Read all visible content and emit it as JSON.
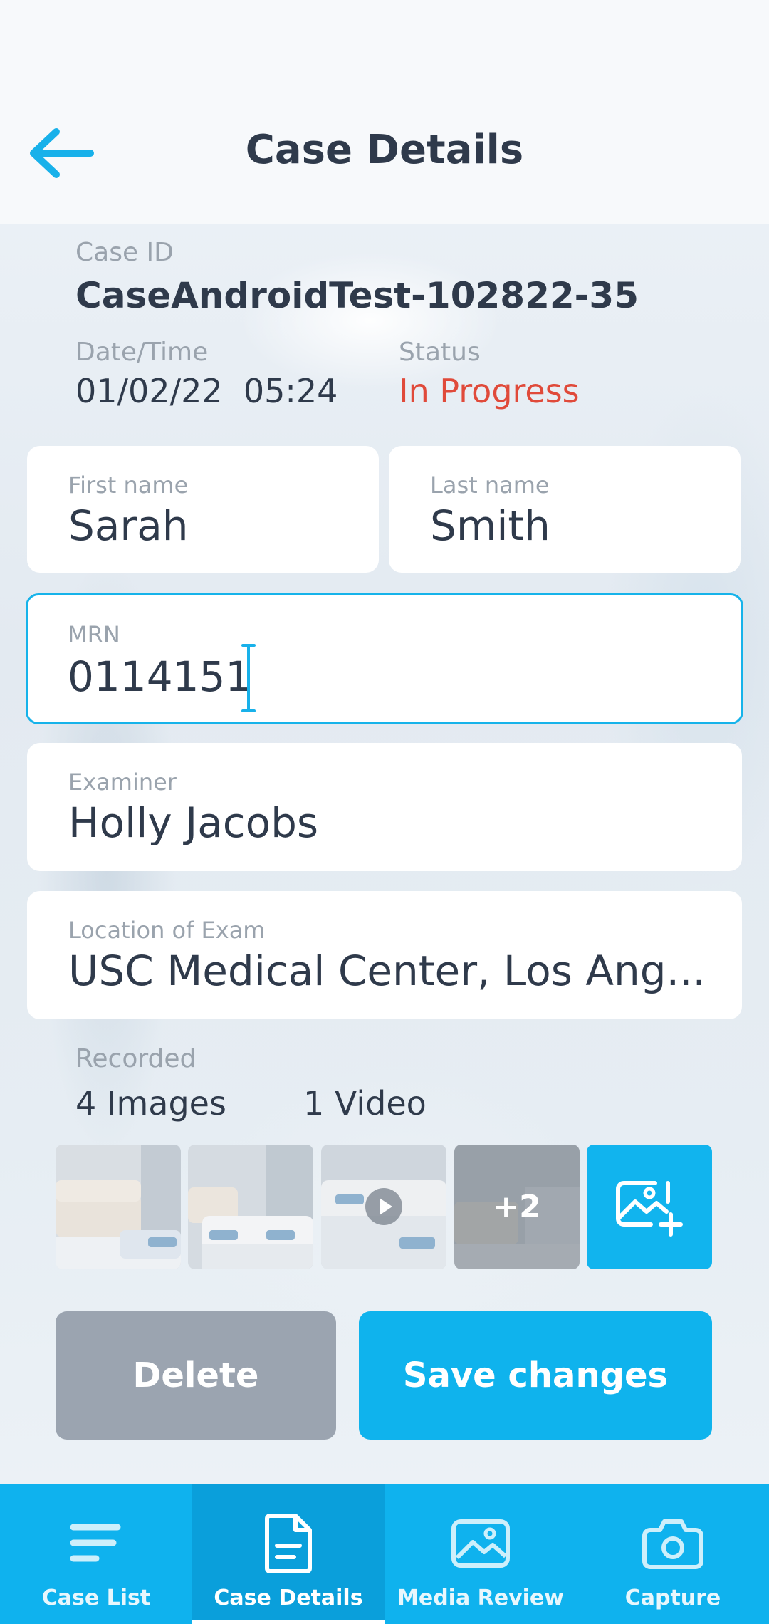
{
  "header": {
    "title": "Case Details"
  },
  "case": {
    "id_label": "Case ID",
    "id_value": "CaseAndroidTest-102822-35",
    "datetime_label": "Date/Time",
    "datetime_value": "01/02/22  05:24",
    "status_label": "Status",
    "status_value": "In Progress"
  },
  "form": {
    "first_name_label": "First name",
    "first_name_value": "Sarah",
    "last_name_label": "Last name",
    "last_name_value": "Smith",
    "mrn_label": "MRN",
    "mrn_value": "0114151",
    "examiner_label": "Examiner",
    "examiner_value": "Holly Jacobs",
    "location_label": "Location of Exam",
    "location_value": "USC Medical Center, Los Ang..."
  },
  "recorded": {
    "label": "Recorded",
    "images": "4 Images",
    "video": "1 Video",
    "more_count": "+2"
  },
  "actions": {
    "delete_label": "Delete",
    "save_label": "Save changes"
  },
  "nav": {
    "items": [
      {
        "label": "Case List",
        "icon": "list-icon"
      },
      {
        "label": "Case Details",
        "icon": "document-icon"
      },
      {
        "label": "Media Review",
        "icon": "image-icon"
      },
      {
        "label": "Capture",
        "icon": "camera-icon"
      }
    ],
    "active": "Case Details"
  },
  "colors": {
    "accent": "#0fb2ee",
    "status": "#e04a3a",
    "delete": "#9ba4b0",
    "text": "#2f3a4b"
  }
}
